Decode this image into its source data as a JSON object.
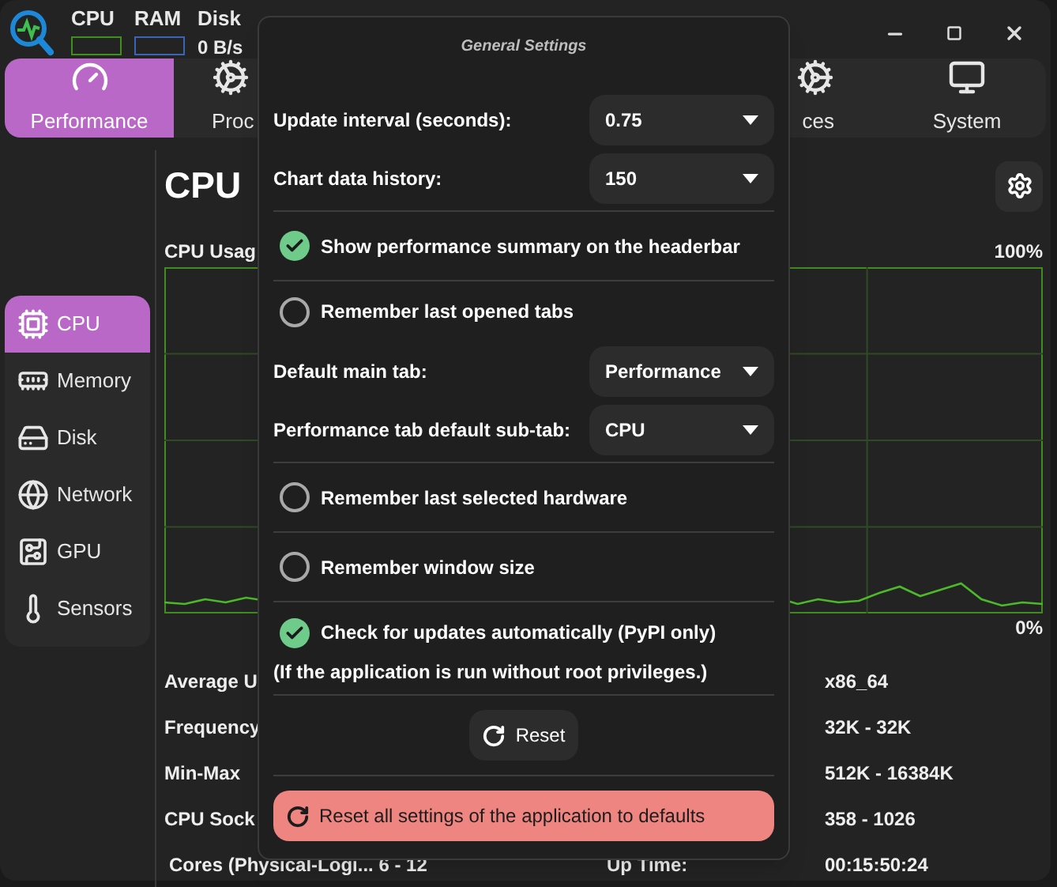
{
  "header_summary": [
    {
      "kind": "meter",
      "label": "CPU",
      "color": "#3f8f1f"
    },
    {
      "kind": "meter",
      "label": "RAM",
      "color": "#3b63b8"
    },
    {
      "kind": "reading",
      "label": "Disk",
      "reading": "0 B/s"
    }
  ],
  "tabs": [
    {
      "label": "Performance",
      "selected": true
    },
    {
      "label": "Proc",
      "selected": false
    },
    {
      "label": "ces",
      "selected": false
    },
    {
      "label": "System",
      "selected": false
    }
  ],
  "sidebar": {
    "items": [
      {
        "label": "CPU",
        "selected": true
      },
      {
        "label": "Memory",
        "selected": false
      },
      {
        "label": "Disk",
        "selected": false
      },
      {
        "label": "Network",
        "selected": false
      },
      {
        "label": "GPU",
        "selected": false
      },
      {
        "label": "Sensors",
        "selected": false
      }
    ]
  },
  "content": {
    "title": "CPU",
    "chart_label": "CPU Usag",
    "chart_max": "100%",
    "chart_min": "0%",
    "info_rows": [
      {
        "label": "Average U",
        "value": "x86_64"
      },
      {
        "label": "Frequency",
        "value": "32K - 32K"
      },
      {
        "label": "Min-Max",
        "value": "512K - 16384K"
      },
      {
        "label": "CPU Sock",
        "value": "358 - 1026"
      },
      {
        "label": "Cores (Physical-Logi... 6 - 12",
        "right_label": "Up Time:",
        "value": "00:15:50:24"
      }
    ]
  },
  "popover": {
    "title": "General Settings",
    "sections": [
      [
        {
          "kind": "dropdown",
          "label": "Update interval (seconds):",
          "value": "0.75"
        },
        {
          "kind": "dropdown",
          "label": "Chart data history:",
          "value": "150"
        }
      ],
      [
        {
          "kind": "check",
          "label": "Show performance summary on the headerbar",
          "checked": true
        }
      ],
      [
        {
          "kind": "check",
          "label": "Remember last opened tabs",
          "checked": false
        },
        {
          "kind": "dropdown",
          "label": "Default main tab:",
          "value": "Performance"
        },
        {
          "kind": "dropdown",
          "label": "Performance tab default sub-tab:",
          "value": "CPU"
        }
      ],
      [
        {
          "kind": "check",
          "label": "Remember last selected hardware",
          "checked": false
        }
      ],
      [
        {
          "kind": "check",
          "label": "Remember window size",
          "checked": false
        }
      ],
      [
        {
          "kind": "check",
          "label": "Check for updates automatically (PyPI only)",
          "checked": true
        },
        {
          "kind": "note",
          "text": "(If the application is run without root privileges.)"
        }
      ],
      [
        {
          "kind": "button",
          "label": "Reset"
        }
      ],
      [
        {
          "kind": "danger_button",
          "label": "Reset all settings of the application to defaults"
        }
      ]
    ]
  }
}
